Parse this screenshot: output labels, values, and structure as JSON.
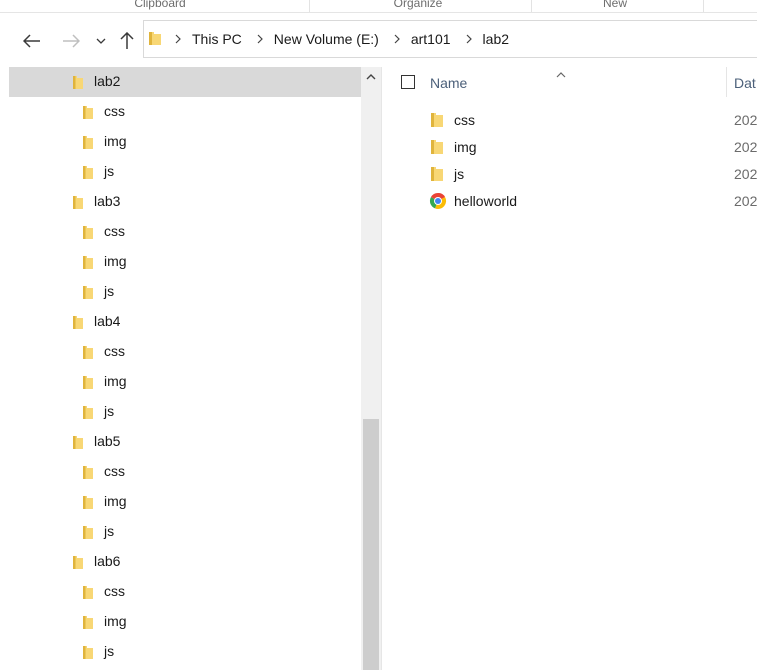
{
  "ribbon": {
    "groups": [
      {
        "label": "Clipboard"
      },
      {
        "label": "Organize"
      },
      {
        "label": "New"
      }
    ]
  },
  "address_bar": {
    "crumbs": [
      "This PC",
      "New Volume (E:)",
      "art101",
      "lab2"
    ]
  },
  "tree": {
    "items": [
      {
        "label": "lab2",
        "level": 0,
        "selected": true
      },
      {
        "label": "css",
        "level": 1
      },
      {
        "label": "img",
        "level": 1
      },
      {
        "label": "js",
        "level": 1
      },
      {
        "label": "lab3",
        "level": 0
      },
      {
        "label": "css",
        "level": 1
      },
      {
        "label": "img",
        "level": 1
      },
      {
        "label": "js",
        "level": 1
      },
      {
        "label": "lab4",
        "level": 0
      },
      {
        "label": "css",
        "level": 1
      },
      {
        "label": "img",
        "level": 1
      },
      {
        "label": "js",
        "level": 1
      },
      {
        "label": "lab5",
        "level": 0
      },
      {
        "label": "css",
        "level": 1
      },
      {
        "label": "img",
        "level": 1
      },
      {
        "label": "js",
        "level": 1
      },
      {
        "label": "lab6",
        "level": 0
      },
      {
        "label": "css",
        "level": 1
      },
      {
        "label": "img",
        "level": 1
      },
      {
        "label": "js",
        "level": 1
      }
    ]
  },
  "file_list": {
    "columns": {
      "name": "Name",
      "date": "Dat"
    },
    "rows": [
      {
        "name": "css",
        "date": "202",
        "icon": "folder-icon"
      },
      {
        "name": "img",
        "date": "202",
        "icon": "folder-icon"
      },
      {
        "name": "js",
        "date": "202",
        "icon": "folder-icon"
      },
      {
        "name": "helloworld",
        "date": "202",
        "icon": "chrome-html-icon"
      }
    ]
  },
  "colors": {
    "folder": "#f8d775",
    "folder_dark": "#e0b43c",
    "selection": "#d9d9d9",
    "header_text": "#4c607a"
  }
}
